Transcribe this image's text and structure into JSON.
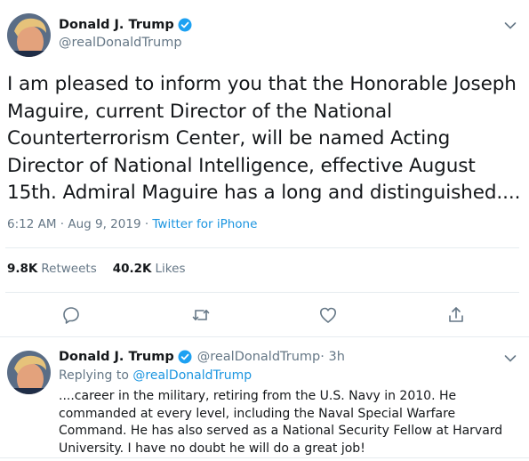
{
  "main_tweet": {
    "author": {
      "display_name": "Donald J. Trump",
      "handle": "@realDonaldTrump",
      "verified_icon": "verified-badge-icon"
    },
    "text": "I am pleased to inform you that the Honorable Joseph Maguire, current Director of the National Counterterrorism Center, will be named Acting Director of National Intelligence, effective August 15th. Admiral Maguire has a long and distinguished....",
    "timestamp": "6:12 AM · Aug 9, 2019 · ",
    "source": "Twitter for iPhone",
    "stats": {
      "retweets_count": "9.8K",
      "retweets_label": "Retweets",
      "likes_count": "40.2K",
      "likes_label": "Likes"
    },
    "actions": [
      "reply-icon",
      "retweet-icon",
      "like-icon",
      "share-icon"
    ]
  },
  "reply_tweet": {
    "author": {
      "display_name": "Donald J. Trump",
      "handle": "@realDonaldTrump",
      "age": " · 3h"
    },
    "replying_label": "Replying to ",
    "replying_handle": "@realDonaldTrump",
    "text": "....career in the military, retiring from the U.S. Navy in 2010. He commanded at every level, including the Naval Special Warfare Command. He has also served as a National Security Fellow at Harvard University. I have no doubt he will do a great job!"
  },
  "colors": {
    "accent": "#1b95e0",
    "muted": "#657786",
    "text": "#14171a",
    "divider": "#e6ecf0",
    "verified": "#1da1f2"
  }
}
